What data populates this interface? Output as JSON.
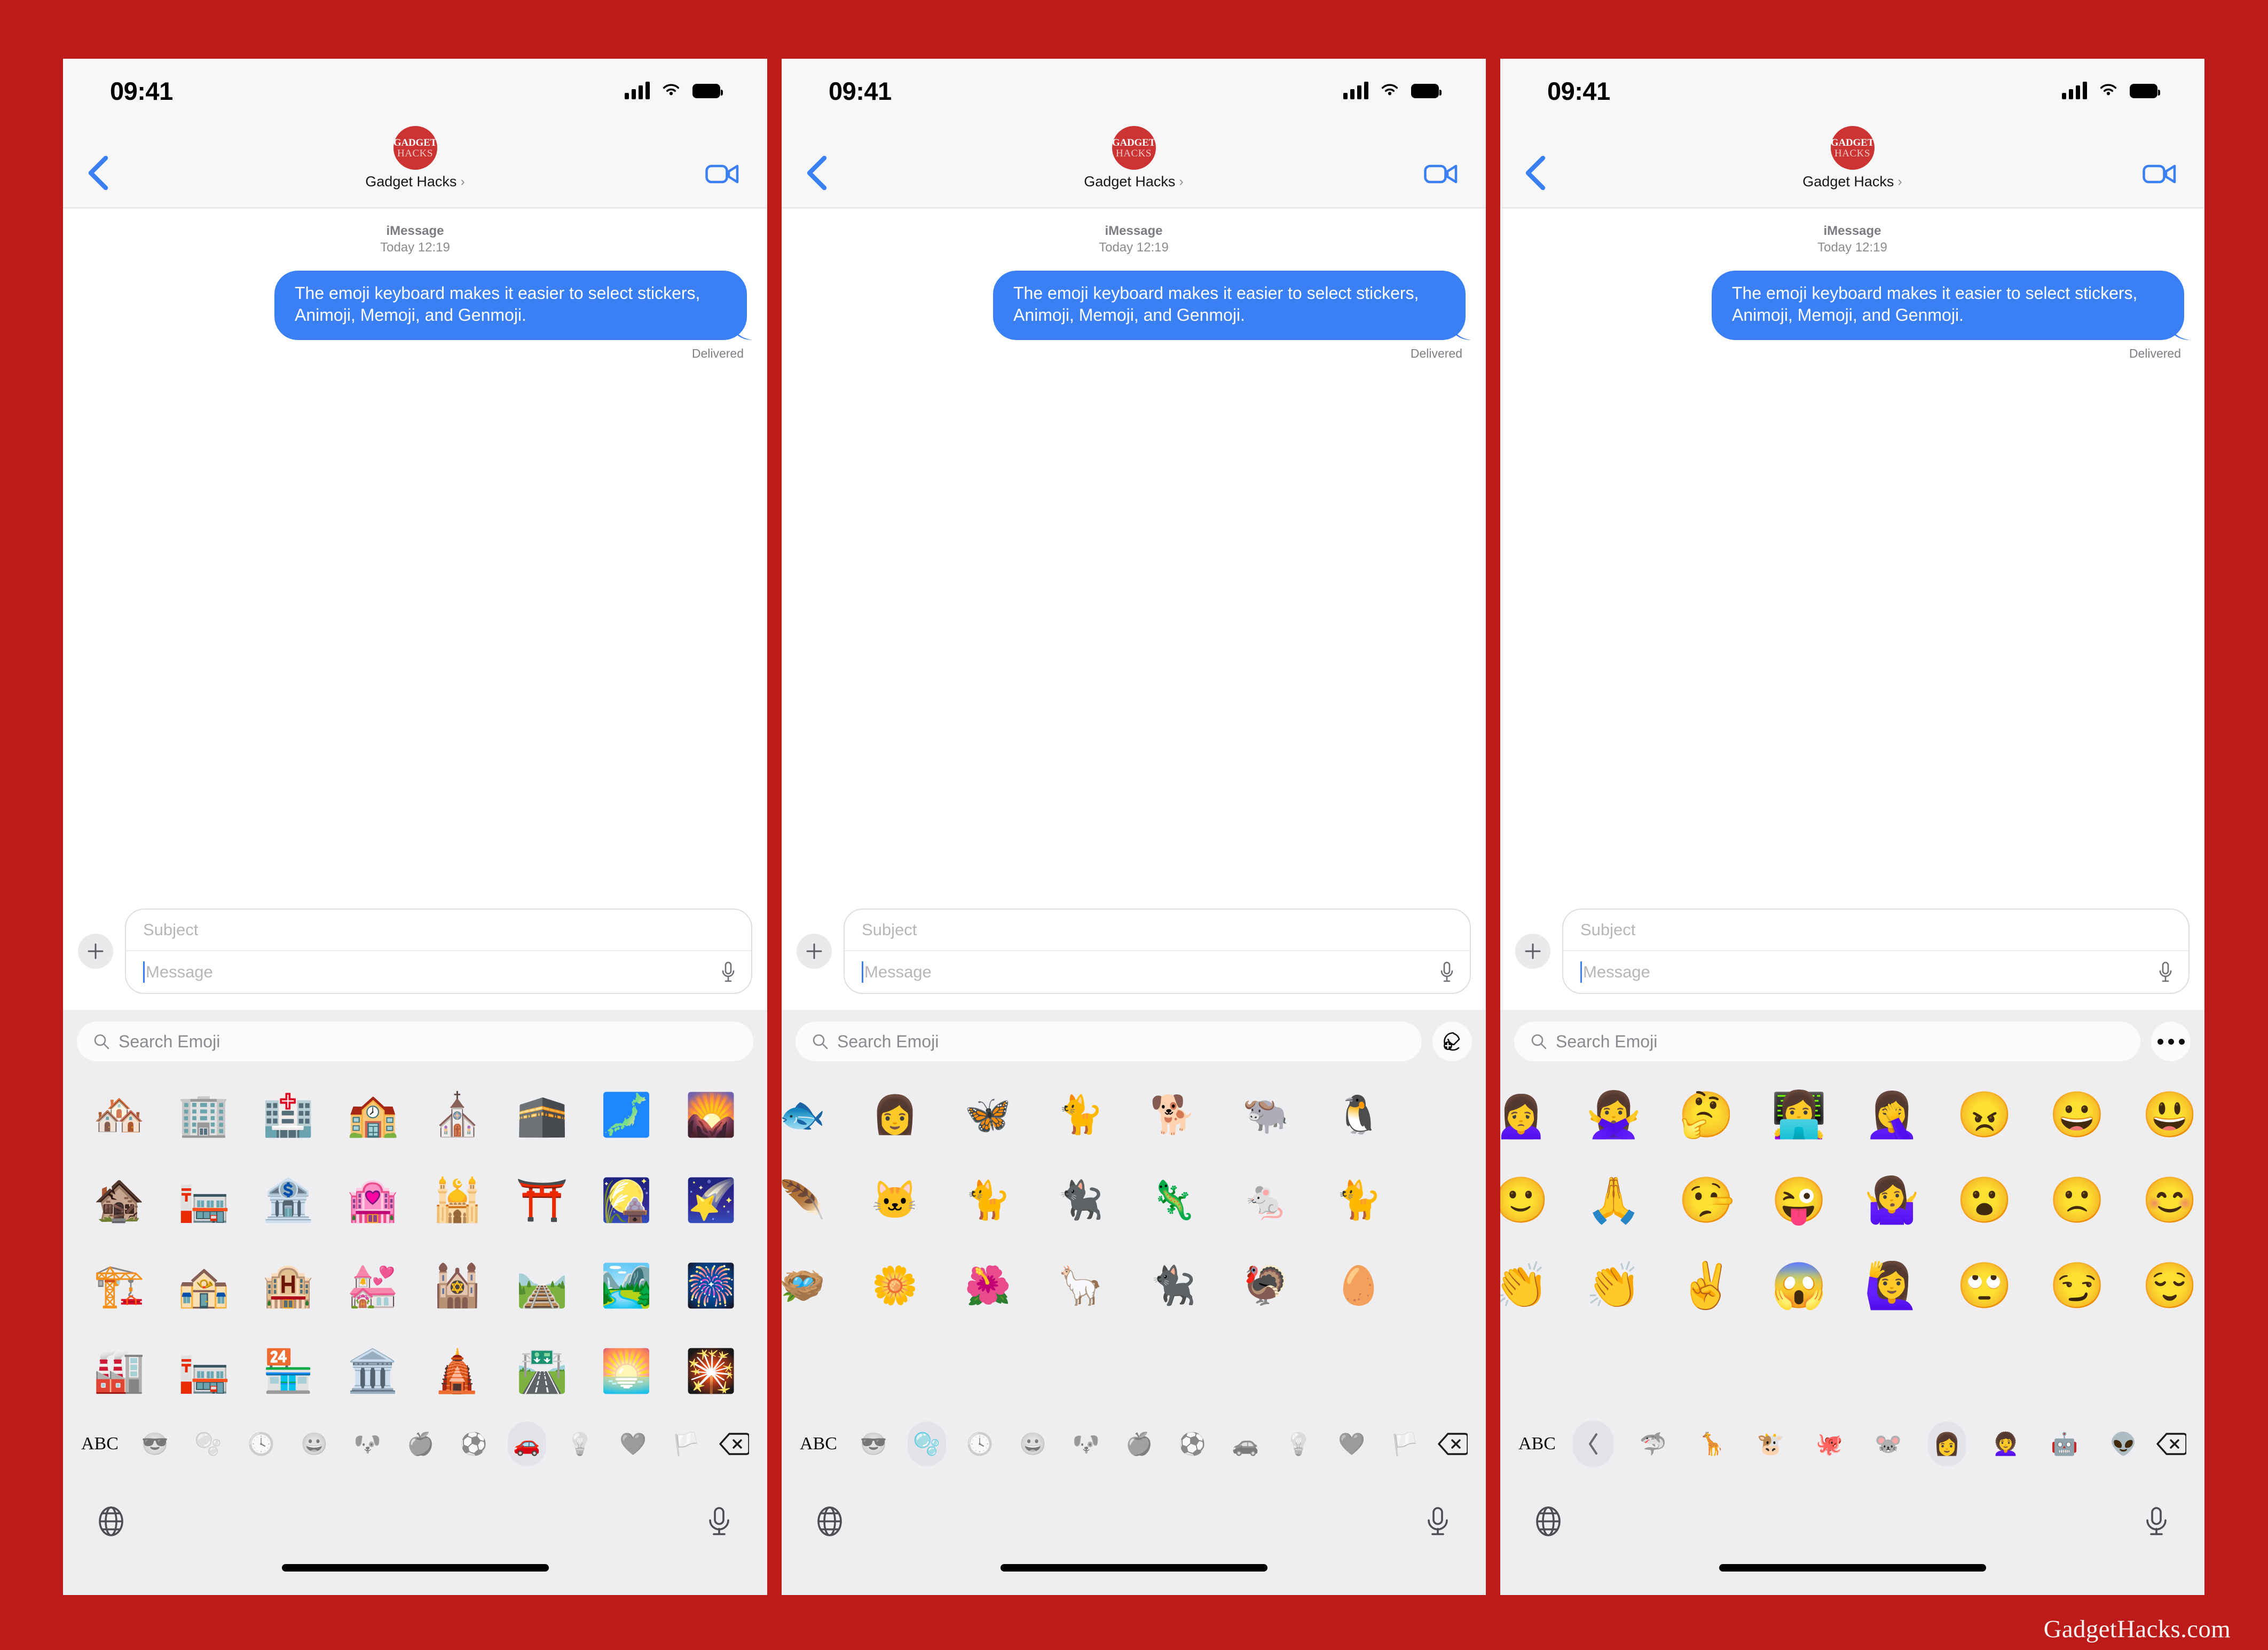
{
  "frame": {
    "accent_color": "#bd1a1a",
    "watermark": "GadgetHacks.com"
  },
  "status_bar": {
    "time": "09:41",
    "cellular_icon": "cellular-bars-icon",
    "wifi_icon": "wifi-icon",
    "battery_icon": "battery-full-icon"
  },
  "nav_bar": {
    "back_icon": "chevron-left-icon",
    "video_icon": "facetime-video-icon",
    "avatar_line1": "GADGET",
    "avatar_line2": "HACKS",
    "contact_name": "Gadget Hacks",
    "chevron": "›"
  },
  "conversation": {
    "service_label": "iMessage",
    "timestamp": "Today 12:19",
    "bubble_text": "The emoji keyboard makes it easier to select stickers, Animoji, Memoji, and Genmoji.",
    "bubble_color": "#3b7ff5",
    "status": "Delivered"
  },
  "composer": {
    "plus_icon": "plus-icon",
    "subject_placeholder": "Subject",
    "message_placeholder": "Message",
    "mic_icon": "microphone-icon"
  },
  "keyboard": {
    "search_placeholder": "Search Emoji",
    "search_icon": "magnifying-glass-icon",
    "abc_label": "ABC",
    "globe_icon": "globe-icon",
    "dictation_icon": "microphone-icon",
    "backspace_icon": "backspace-delete-icon"
  },
  "panels": [
    {
      "id": "panel-emoji",
      "name": "emoji-keyboard-panel",
      "accessory_button": null,
      "selected_category": "travel-places",
      "categories": [
        {
          "name": "recents",
          "glyph": "😎"
        },
        {
          "name": "stickers",
          "glyph": "🫧"
        },
        {
          "name": "frequently-used",
          "glyph": "🕓"
        },
        {
          "name": "smileys-people",
          "glyph": "😀"
        },
        {
          "name": "animals-nature",
          "glyph": "🐶"
        },
        {
          "name": "food-drink",
          "glyph": "🍎"
        },
        {
          "name": "activity",
          "glyph": "⚽"
        },
        {
          "name": "travel-places",
          "glyph": "🚗"
        },
        {
          "name": "objects",
          "glyph": "💡"
        },
        {
          "name": "symbols",
          "glyph": "❤️"
        },
        {
          "name": "flags",
          "glyph": "🏳️"
        }
      ],
      "grid": [
        "🏘️",
        "🏢",
        "🏥",
        "🏫",
        "⛪",
        "🕋",
        "🗾",
        "🌄",
        "🏚️",
        "🏣",
        "🏦",
        "🏩",
        "🕌",
        "⛩️",
        "🎑",
        "🌠",
        "🏗️",
        "🏤",
        "🏨",
        "💒",
        "🕍",
        "🛤️",
        "🏞️",
        "🎆",
        "🏭",
        "🏣",
        "🏪",
        "🏛️",
        "🛕",
        "🛣️",
        "🌅",
        "🎇"
      ]
    },
    {
      "id": "panel-stickers",
      "name": "sticker-keyboard-panel",
      "accessory_button": "add-sticker-button",
      "selected_category": "stickers",
      "categories": [
        {
          "name": "recents",
          "glyph": "😎"
        },
        {
          "name": "stickers",
          "glyph": "🫧"
        },
        {
          "name": "frequently-used",
          "glyph": "🕓"
        },
        {
          "name": "smileys-people",
          "glyph": "😀"
        },
        {
          "name": "animals-nature",
          "glyph": "🐶"
        },
        {
          "name": "food-drink",
          "glyph": "🍎"
        },
        {
          "name": "activity",
          "glyph": "⚽"
        },
        {
          "name": "travel-places",
          "glyph": "🚗"
        },
        {
          "name": "objects",
          "glyph": "💡"
        },
        {
          "name": "symbols",
          "glyph": "❤️"
        },
        {
          "name": "flags",
          "glyph": "🏳️"
        }
      ],
      "grid": [
        "🐟",
        "👩",
        "🦋",
        "🐈",
        "🐕",
        "🐃",
        "🐧",
        "",
        "🪶",
        "🐱",
        "🐈",
        "🐈‍⬛",
        "🦎",
        "🐁",
        "🐈",
        "",
        "🪺",
        "🌼",
        "🌺",
        "🦙",
        "🐈‍⬛",
        "🦃",
        "🥚",
        ""
      ]
    },
    {
      "id": "panel-memoji",
      "name": "memoji-keyboard-panel",
      "accessory_button": "more-options-button",
      "selected_category": "memoji-pink-face",
      "categories": [
        {
          "name": "back-chevron",
          "glyph": "‹"
        },
        {
          "name": "animoji-shark",
          "glyph": "🦈"
        },
        {
          "name": "animoji-giraffe",
          "glyph": "🦒"
        },
        {
          "name": "animoji-cow",
          "glyph": "🐮"
        },
        {
          "name": "animoji-octopus",
          "glyph": "🐙"
        },
        {
          "name": "animoji-mouse",
          "glyph": "🐭"
        },
        {
          "name": "memoji-pink-face",
          "glyph": "👩"
        },
        {
          "name": "memoji-glasses",
          "glyph": "👩‍🦱"
        },
        {
          "name": "animoji-robot",
          "glyph": "🤖"
        },
        {
          "name": "animoji-alien",
          "glyph": "👽"
        }
      ],
      "grid": [
        "🙍‍♀️",
        "🙅‍♀️",
        "🤔",
        "👩‍💻",
        "🤦‍♀️",
        "😠",
        "😀",
        "😃",
        "🙂",
        "🙏",
        "🤥",
        "😜",
        "🤷‍♀️",
        "😮",
        "🙁",
        "😊",
        "👏",
        "👏",
        "✌️",
        "😱",
        "🙋‍♀️",
        "🙄",
        "😏",
        "😌"
      ]
    }
  ]
}
